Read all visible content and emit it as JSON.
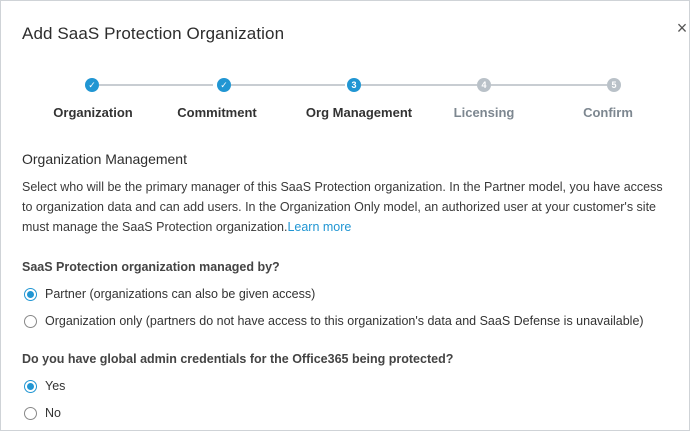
{
  "dialog": {
    "title": "Add SaaS Protection Organization",
    "close_glyph": "×"
  },
  "stepper": {
    "steps": [
      {
        "label": "Organization",
        "marker": "✓",
        "state": "done"
      },
      {
        "label": "Commitment",
        "marker": "✓",
        "state": "done"
      },
      {
        "label": "Org Management",
        "marker": "3",
        "state": "current"
      },
      {
        "label": "Licensing",
        "marker": "4",
        "state": "pending"
      },
      {
        "label": "Confirm",
        "marker": "5",
        "state": "pending"
      }
    ]
  },
  "section": {
    "title": "Organization Management",
    "description": "Select who will be the primary manager of this SaaS Protection organization. In the Partner model, you have access to organization data and can add users. In the Organization Only model, an authorized user at your customer's site must manage the SaaS Protection organization.",
    "learn_more": "Learn more"
  },
  "question1": {
    "label": "SaaS Protection organization managed by?",
    "options": [
      {
        "label": "Partner (organizations can also be given access)",
        "selected": true
      },
      {
        "label": "Organization only (partners do not have access to this organization's data and SaaS Defense is unavailable)",
        "selected": false
      }
    ]
  },
  "question2": {
    "label": "Do you have global admin credentials for the Office365 being protected?",
    "options": [
      {
        "label": "Yes",
        "selected": true
      },
      {
        "label": "No",
        "selected": false
      }
    ]
  },
  "colors": {
    "accent": "#2196d3",
    "pending": "#b9c1c8"
  }
}
